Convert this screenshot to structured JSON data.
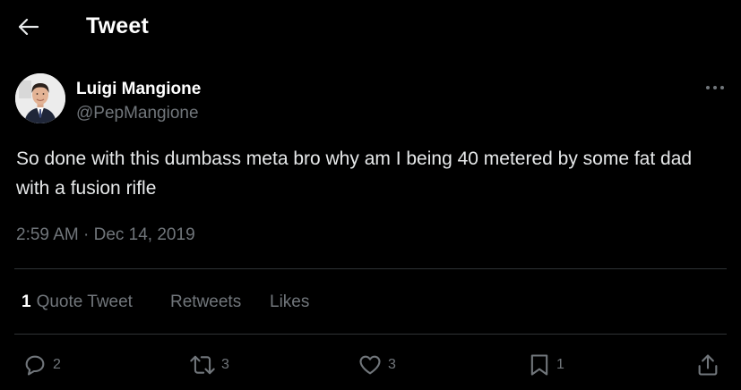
{
  "header": {
    "title": "Tweet",
    "back_icon": "arrow-left-icon"
  },
  "author": {
    "display_name": "Luigi Mangione",
    "handle": "@PepMangione",
    "avatar_icon": "profile-photo"
  },
  "more_icon": "more-dots-icon",
  "tweet": {
    "text": "So done with this dumbass meta bro why am I being 40 metered by some fat dad with a fusion rifle",
    "time": "2:59 AM",
    "separator": "·",
    "date": "Dec 14, 2019"
  },
  "stats": {
    "quote_count": "1",
    "quote_label": "Quote Tweet",
    "retweets_label": "Retweets",
    "likes_label": "Likes"
  },
  "actions": {
    "reply_count": "2",
    "retweet_count": "3",
    "like_count": "3",
    "bookmark_count": "1"
  },
  "colors": {
    "background": "#000000",
    "text_primary": "#e7e9ea",
    "text_secondary": "#71767b",
    "divider": "#2f3336"
  }
}
